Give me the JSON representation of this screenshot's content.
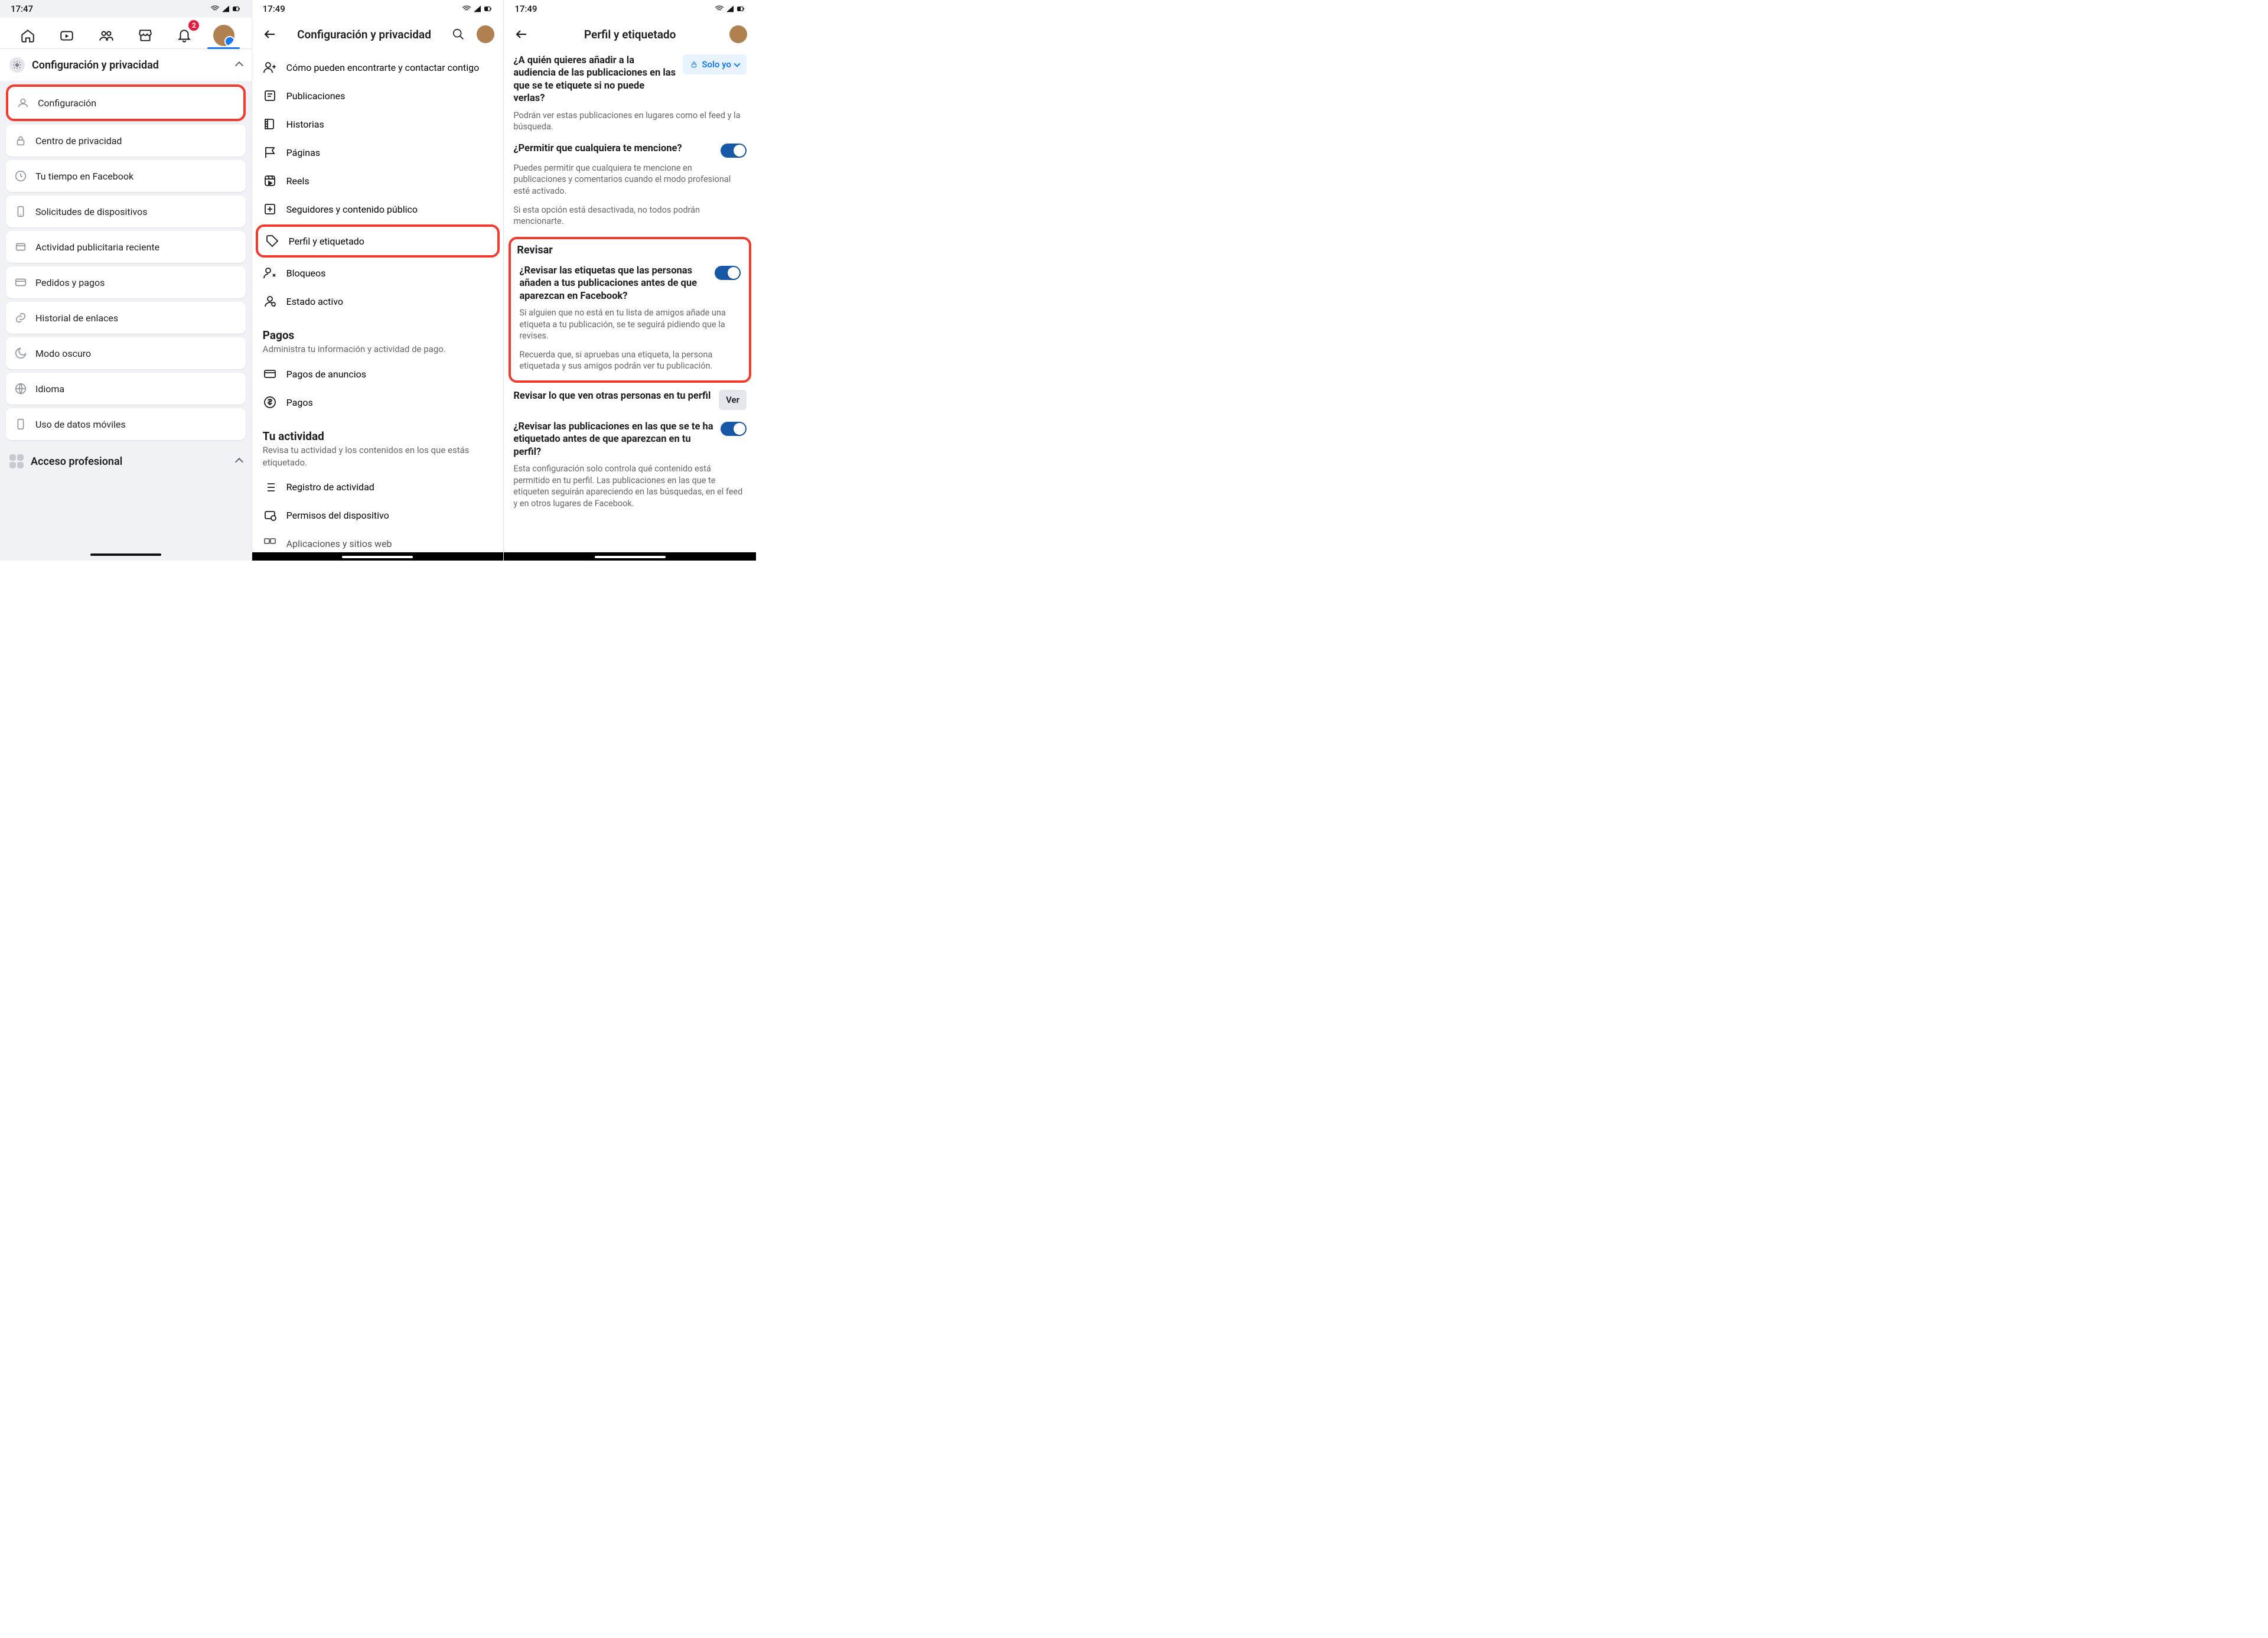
{
  "panel1": {
    "time": "17:47",
    "notification_count": "2",
    "header_title": "Configuración y privacidad",
    "menu": [
      "Configuración",
      "Centro de privacidad",
      "Tu tiempo en Facebook",
      "Solicitudes de dispositivos",
      "Actividad publicitaria reciente",
      "Pedidos y pagos",
      "Historial de enlaces",
      "Modo oscuro",
      "Idioma",
      "Uso de datos móviles"
    ],
    "footer_section": "Acceso profesional"
  },
  "panel2": {
    "time": "17:49",
    "header_title": "Configuración y privacidad",
    "audience_items": [
      "Cómo pueden encontrarte y contactar contigo",
      "Publicaciones",
      "Historias",
      "Páginas",
      "Reels",
      "Seguidores y contenido público",
      "Perfil y etiquetado",
      "Bloqueos",
      "Estado activo"
    ],
    "sections": {
      "pagos": {
        "title": "Pagos",
        "subtitle": "Administra tu información y actividad de pago."
      },
      "pagos_items": [
        "Pagos de anuncios",
        "Pagos"
      ],
      "actividad": {
        "title": "Tu actividad",
        "subtitle": "Revisa tu actividad y los contenidos en los que estás etiquetado."
      },
      "actividad_items": [
        "Registro de actividad",
        "Permisos del dispositivo",
        "Aplicaciones y sitios web"
      ]
    }
  },
  "panel3": {
    "time": "17:49",
    "header_title": "Perfil y etiquetado",
    "q1": {
      "title": "¿A quién quieres añadir a la audiencia de las publicaciones en las que se te etiquete si no puede verlas?",
      "value": "Solo yo",
      "desc": "Podrán ver estas publicaciones en lugares como el feed y la búsqueda."
    },
    "q2": {
      "title": "¿Permitir que cualquiera te mencione?",
      "desc1": "Puedes permitir que cualquiera te mencione en publicaciones y comentarios cuando el modo profesional esté activado.",
      "desc2": "Si esta opción está desactivada, no todos podrán mencionarte."
    },
    "revisar": {
      "heading": "Revisar",
      "q": "¿Revisar las etiquetas que las personas añaden a tus publicaciones antes de que aparezcan en Facebook?",
      "d1": "Si alguien que no está en tu lista de amigos añade una etiqueta a tu publicación, se te seguirá pidiendo que la revises.",
      "d2": "Recuerda que, si apruebas una etiqueta, la persona etiquetada y sus amigos podrán ver tu publicación."
    },
    "q4": {
      "title": "Revisar lo que ven otras personas en tu perfil",
      "button": "Ver"
    },
    "q5": {
      "title": "¿Revisar las publicaciones en las que se te ha etiquetado antes de que aparezcan en tu perfil?",
      "desc": "Esta configuración solo controla qué contenido está permitido en tu perfil. Las publicaciones en las que te etiqueten seguirán apareciendo en las búsquedas, en el feed y en otros lugares de Facebook."
    }
  }
}
